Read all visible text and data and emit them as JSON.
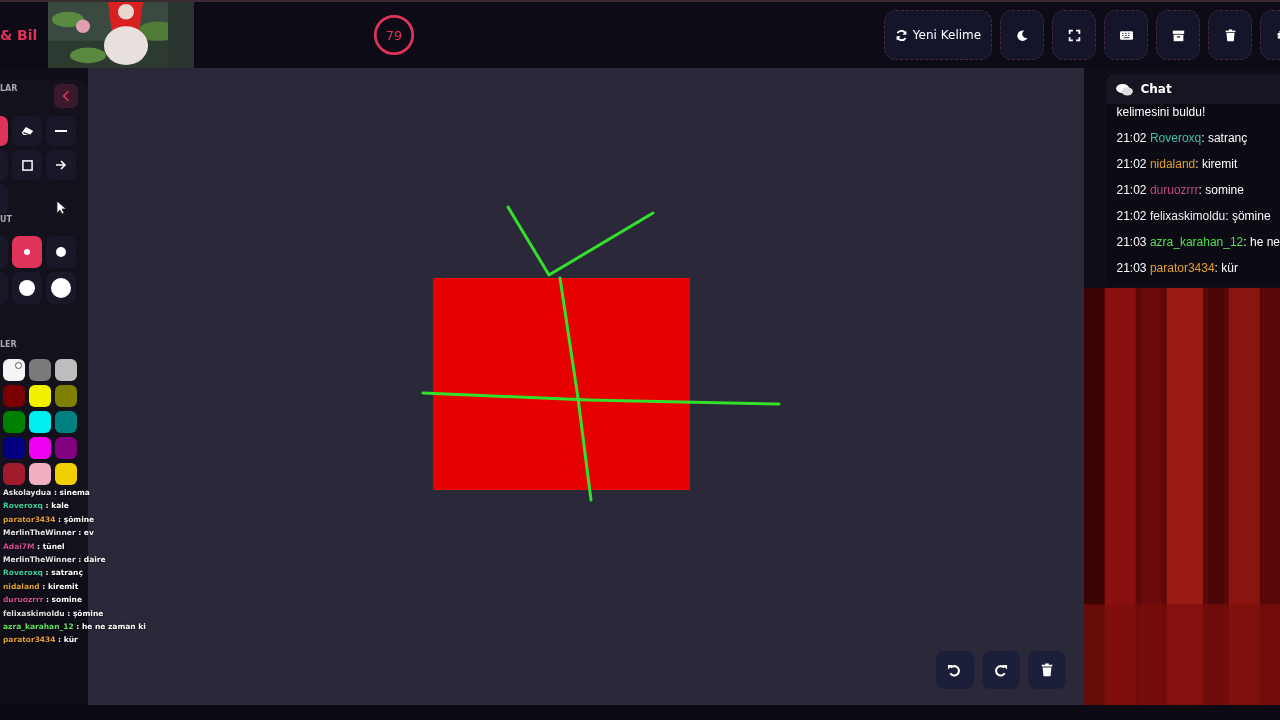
{
  "header": {
    "title": "& Bil",
    "timer": {
      "value": "79"
    },
    "buttons": [
      {
        "kind": "new-word",
        "label": "Yeni Kelime"
      },
      {
        "kind": "theme"
      },
      {
        "kind": "fullscreen"
      },
      {
        "kind": "keyboard"
      },
      {
        "kind": "archive"
      },
      {
        "kind": "trash"
      },
      {
        "kind": "settings"
      }
    ]
  },
  "tool_panel": {
    "tools_label": "LAR",
    "size_label": "UT",
    "colors_label": "LER",
    "tools": [
      {
        "kind": "partial",
        "selected": true
      },
      {
        "kind": "eraser",
        "selected": false
      },
      {
        "kind": "line",
        "selected": false
      },
      {
        "kind": "partial",
        "selected": false
      },
      {
        "kind": "rectangle",
        "selected": false
      },
      {
        "kind": "arrow",
        "selected": false
      },
      {
        "kind": "partial",
        "selected": false
      }
    ],
    "sizes": [
      {
        "kind": "xs",
        "selected": false
      },
      {
        "kind": "s",
        "selected": true
      },
      {
        "kind": "m",
        "selected": false
      },
      {
        "kind": "l",
        "selected": false
      },
      {
        "kind": "xl",
        "selected": false
      },
      {
        "kind": "xxl",
        "selected": false
      }
    ],
    "colors": [
      {
        "color": "#f4f4f4",
        "selected": true
      },
      {
        "color": "#7a7a7a",
        "selected": false
      },
      {
        "color": "#bdbdbd",
        "selected": false
      },
      {
        "color": "#7a0000",
        "selected": false
      },
      {
        "color": "#f2f200",
        "selected": false
      },
      {
        "color": "#808000",
        "selected": false
      },
      {
        "color": "#008000",
        "selected": false
      },
      {
        "color": "#00f0f0",
        "selected": false
      },
      {
        "color": "#008080",
        "selected": false
      },
      {
        "color": "#000080",
        "selected": false
      },
      {
        "color": "#f000f0",
        "selected": false
      },
      {
        "color": "#800080",
        "selected": false
      },
      {
        "color": "#a01c2c",
        "selected": false
      },
      {
        "color": "#f0b0c0",
        "selected": false
      },
      {
        "color": "#f0d000",
        "selected": false
      }
    ]
  },
  "stream_chat": [
    {
      "user": "Askolaydua",
      "text": ": sinema",
      "color": "#e8e8e8"
    },
    {
      "user": "Roveroxq",
      "text": ": kale",
      "color": "#3fd0a0"
    },
    {
      "user": "parator3434",
      "text": ": şömine",
      "color": "#e0a030"
    },
    {
      "user": "MerlinTheWinner",
      "text": ": ev",
      "color": "#e8e8e8"
    },
    {
      "user": "Adai7M",
      "text": ": tünel",
      "color": "#d05090"
    },
    {
      "user": "MerlinTheWinner",
      "text": ": daire",
      "color": "#e8e8e8"
    },
    {
      "user": "Roveroxq",
      "text": ": satranç",
      "color": "#3fd0a0"
    },
    {
      "user": "nidaland",
      "text": ": kiremit",
      "color": "#e0a030"
    },
    {
      "user": "duruozrrr",
      "text": ": somine",
      "color": "#d05090"
    },
    {
      "user": "felixaskimoldu",
      "text": ": şömine",
      "color": "#e0e0e0"
    },
    {
      "user": "azra_karahan_12",
      "text": ": he ne zaman ki",
      "color": "#60e060"
    },
    {
      "user": "parator3434",
      "text": ": kür",
      "color": "#e0a030"
    }
  ],
  "chat": {
    "title": "Chat",
    "first_line": "kelimesini buldu!",
    "messages": [
      {
        "time": "21:02",
        "user": "Roveroxq",
        "text": ": satranç",
        "color": "#3fc0a8"
      },
      {
        "time": "21:02",
        "user": "nidaland",
        "text": ": kiremit",
        "color": "#e0a030"
      },
      {
        "time": "21:02",
        "user": "duruozrrr",
        "text": ": somine",
        "color": "#c04878"
      },
      {
        "time": "21:02",
        "user": "felixaskimoldu",
        "text": ": şömine",
        "color": "#f0f0f0"
      },
      {
        "time": "21:03",
        "user": "azra_karahan_12",
        "text": ": he ne",
        "color": "#50e050"
      },
      {
        "time": "21:03",
        "user": "parator3434",
        "text": ": kür",
        "color": "#e0a030"
      }
    ]
  },
  "canvas_actions": [
    {
      "kind": "undo"
    },
    {
      "kind": "redo"
    },
    {
      "kind": "clear"
    }
  ]
}
